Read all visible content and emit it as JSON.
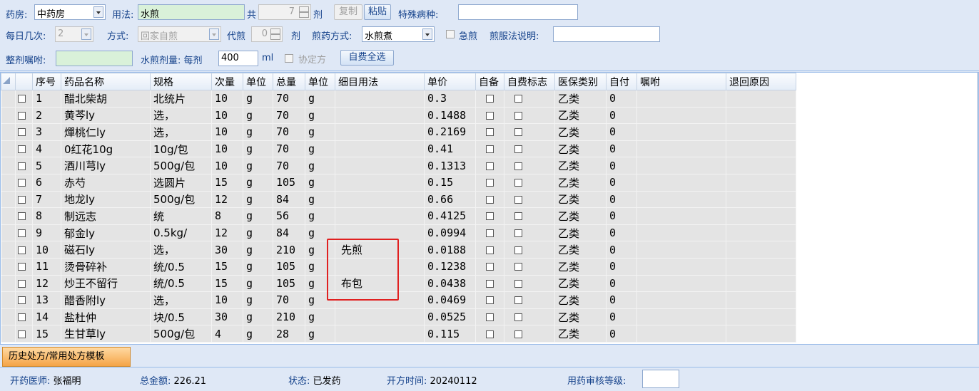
{
  "form": {
    "pharmacy_label": "药房:",
    "pharmacy_value": "中药房",
    "usage_label": "用法:",
    "usage_value": "水煎",
    "total_label": "共",
    "total_value": "7",
    "dose_unit": "剂",
    "copy_button": "复制",
    "paste_button": "粘贴",
    "special_disease_label": "特殊病种:",
    "special_disease_value": "",
    "daily_times_label": "每日几次:",
    "daily_times_value": "2",
    "method_label": "方式:",
    "method_value": "回家自煎",
    "proxy_label": "代煎",
    "proxy_value": "0",
    "proxy_unit": "剂",
    "decoct_method_label": "煎药方式:",
    "decoct_method_value": "水煎煮",
    "urgent_label": "急煎",
    "decoct_note_label": "煎服法说明:",
    "decoct_note_value": "",
    "whole_note_label": "整剂嘱咐:",
    "whole_note_value": "",
    "water_dose_label": "水煎剂量: 每剂",
    "water_dose_value": "400",
    "water_dose_unit": "ml",
    "agreement_label": "协定方",
    "self_pay_all_button": "自费全选"
  },
  "table": {
    "columns": [
      "序号",
      "药品名称",
      "规格",
      "次量",
      "单位",
      "总量",
      "单位",
      "细目用法",
      "单价",
      "自备",
      "自费标志",
      "医保类别",
      "自付",
      "嘱咐",
      "退回原因"
    ],
    "rows": [
      {
        "no": "1",
        "name": "醋北柴胡",
        "spec": "北统片",
        "qty": "10",
        "unit": "g",
        "total": "70",
        "tunit": "g",
        "usage": "",
        "price": "0.3",
        "category": "乙类",
        "selfpay": "0"
      },
      {
        "no": "2",
        "name": "黄芩ly",
        "spec": "选，",
        "qty": "10",
        "unit": "g",
        "total": "70",
        "tunit": "g",
        "usage": "",
        "price": "0.1488",
        "category": "乙类",
        "selfpay": "0"
      },
      {
        "no": "3",
        "name": "燀桃仁ly",
        "spec": "选，",
        "qty": "10",
        "unit": "g",
        "total": "70",
        "tunit": "g",
        "usage": "",
        "price": "0.2169",
        "category": "乙类",
        "selfpay": "0"
      },
      {
        "no": "4",
        "name": "0红花10g",
        "spec": "10g/包",
        "qty": "10",
        "unit": "g",
        "total": "70",
        "tunit": "g",
        "usage": "",
        "price": "0.41",
        "category": "乙类",
        "selfpay": "0"
      },
      {
        "no": "5",
        "name": "酒川芎ly",
        "spec": "500g/包",
        "qty": "10",
        "unit": "g",
        "total": "70",
        "tunit": "g",
        "usage": "",
        "price": "0.1313",
        "category": "乙类",
        "selfpay": "0"
      },
      {
        "no": "6",
        "name": "赤芍",
        "spec": "选圆片",
        "qty": "15",
        "unit": "g",
        "total": "105",
        "tunit": "g",
        "usage": "",
        "price": "0.15",
        "category": "乙类",
        "selfpay": "0"
      },
      {
        "no": "7",
        "name": "地龙ly",
        "spec": "500g/包",
        "qty": "12",
        "unit": "g",
        "total": "84",
        "tunit": "g",
        "usage": "",
        "price": "0.66",
        "category": "乙类",
        "selfpay": "0"
      },
      {
        "no": "8",
        "name": "制远志",
        "spec": "统",
        "qty": "8",
        "unit": "g",
        "total": "56",
        "tunit": "g",
        "usage": "",
        "price": "0.4125",
        "category": "乙类",
        "selfpay": "0"
      },
      {
        "no": "9",
        "name": "郁金ly",
        "spec": "0.5kg/",
        "qty": "12",
        "unit": "g",
        "total": "84",
        "tunit": "g",
        "usage": "",
        "price": "0.0994",
        "category": "乙类",
        "selfpay": "0"
      },
      {
        "no": "10",
        "name": "磁石ly",
        "spec": "选，",
        "qty": "30",
        "unit": "g",
        "total": "210",
        "tunit": "g",
        "usage": "先煎",
        "price": "0.0188",
        "category": "乙类",
        "selfpay": "0"
      },
      {
        "no": "11",
        "name": "烫骨碎补",
        "spec": "统/0.5",
        "qty": "15",
        "unit": "g",
        "total": "105",
        "tunit": "g",
        "usage": "",
        "price": "0.1238",
        "category": "乙类",
        "selfpay": "0"
      },
      {
        "no": "12",
        "name": "炒王不留行",
        "spec": "统/0.5",
        "qty": "15",
        "unit": "g",
        "total": "105",
        "tunit": "g",
        "usage": "布包",
        "price": "0.0438",
        "category": "乙类",
        "selfpay": "0"
      },
      {
        "no": "13",
        "name": "醋香附ly",
        "spec": "选，",
        "qty": "10",
        "unit": "g",
        "total": "70",
        "tunit": "g",
        "usage": "",
        "price": "0.0469",
        "category": "乙类",
        "selfpay": "0"
      },
      {
        "no": "14",
        "name": "盐杜仲",
        "spec": "块/0.5",
        "qty": "30",
        "unit": "g",
        "total": "210",
        "tunit": "g",
        "usage": "",
        "price": "0.0525",
        "category": "乙类",
        "selfpay": "0"
      },
      {
        "no": "15",
        "name": "生甘草ly",
        "spec": "500g/包",
        "qty": "4",
        "unit": "g",
        "total": "28",
        "tunit": "g",
        "usage": "",
        "price": "0.115",
        "category": "乙类",
        "selfpay": "0"
      }
    ]
  },
  "tabs": {
    "history_label": "历史处方/常用处方模板"
  },
  "status": {
    "doctor_label": "开药医师:",
    "doctor_value": "张福明",
    "amount_label": "总金额:",
    "amount_value": "226.21",
    "state_label": "状态:",
    "state_value": "已发药",
    "time_label": "开方时间:",
    "time_value": "20240112",
    "review_label": "用药审核等级:",
    "review_value": ""
  },
  "colors": {
    "accent": "#15428b",
    "highlight_border": "#e02020",
    "tab_active": "#f5a446"
  }
}
